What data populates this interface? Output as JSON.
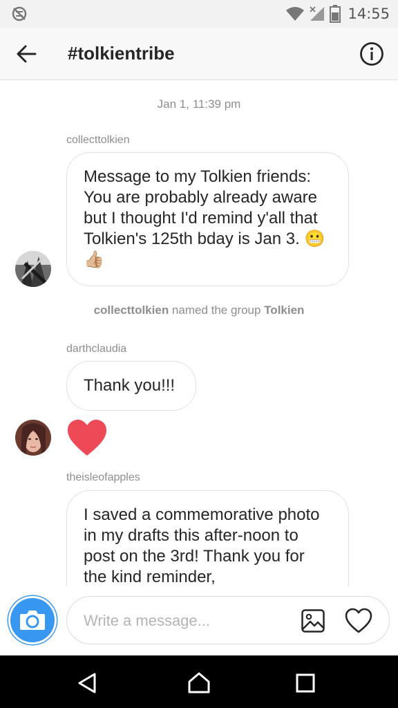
{
  "status_bar": {
    "time": "14:55",
    "icons": [
      "no-sync-icon",
      "wifi-icon",
      "signal-icon",
      "battery-icon"
    ]
  },
  "header": {
    "title": "#tolkientribe",
    "back_icon": "arrow-left-icon",
    "info_icon": "info-icon"
  },
  "conversation": {
    "timestamp": "Jan 1, 11:39 pm",
    "messages": [
      {
        "sender": "collecttolkien",
        "text": "Message to my Tolkien friends: You are probably already aware but I thought I'd remind y'all that Tolkien's 125th bday is Jan 3. 😬👍🏼"
      },
      {
        "sender": "darthclaudia",
        "text": "Thank you!!!",
        "reaction": "❤"
      },
      {
        "sender": "theisleofapples",
        "text": "I saved a commemorative photo in my drafts this after-noon to post on the 3rd! Thank you for the kind reminder,"
      }
    ],
    "system_message": {
      "actor": "collecttolkien",
      "action": " named the group ",
      "group_name": "Tolkien"
    }
  },
  "composer": {
    "placeholder": "Write a message...",
    "camera_icon": "camera-icon",
    "gallery_icon": "gallery-icon",
    "like_icon": "heart-outline-icon"
  },
  "colors": {
    "accent": "#3897f0",
    "heart": "#ed4956",
    "text_secondary": "#8e8e8e"
  }
}
